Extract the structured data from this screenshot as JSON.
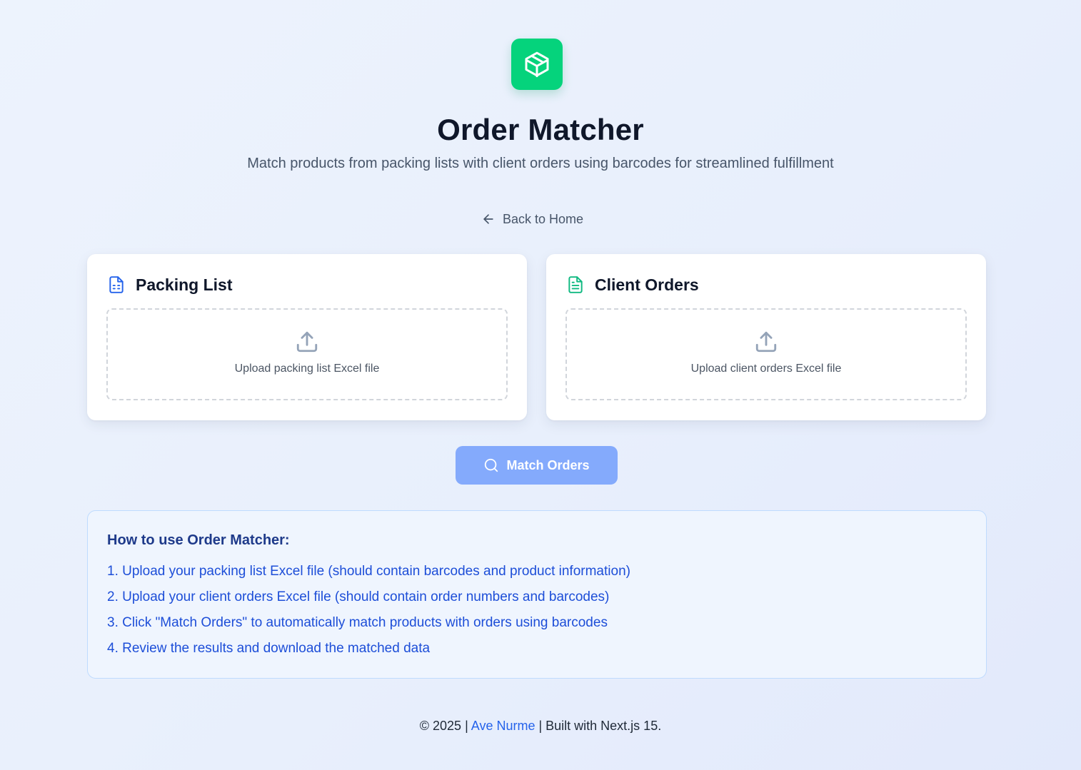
{
  "header": {
    "logo_icon": "package-box-icon",
    "title": "Order Matcher",
    "subtitle": "Match products from packing lists with client orders using barcodes for streamlined fulfillment"
  },
  "nav": {
    "back_icon": "arrow-left-icon",
    "back_label": "Back to Home"
  },
  "packing_card": {
    "icon": "spreadsheet-file-icon",
    "title": "Packing List",
    "upload_icon": "upload-icon",
    "upload_text": "Upload packing list Excel file"
  },
  "orders_card": {
    "icon": "document-file-icon",
    "title": "Client Orders",
    "upload_icon": "upload-icon",
    "upload_text": "Upload client orders Excel file"
  },
  "match_button": {
    "icon": "search-icon",
    "label": "Match Orders"
  },
  "instructions": {
    "title": "How to use Order Matcher:",
    "steps": [
      "1. Upload your packing list Excel file (should contain barcodes and product information)",
      "2. Upload your client orders Excel file (should contain order numbers and barcodes)",
      "3. Click \"Match Orders\" to automatically match products with orders using barcodes",
      "4. Review the results and download the matched data"
    ]
  },
  "footer": {
    "prefix": "© 2025 | ",
    "author": "Ave Nurme",
    "suffix": " | Built with Next.js 15."
  },
  "colors": {
    "logo_bg": "#05d37c",
    "packing_icon": "#2563eb",
    "orders_icon": "#10b981",
    "button_bg": "#84aafc",
    "instructions_bg": "#eff5fe",
    "instructions_border": "#bfdbfe",
    "instructions_title": "#1e3a8a",
    "instructions_text": "#1d4ed8",
    "link": "#2563eb"
  }
}
